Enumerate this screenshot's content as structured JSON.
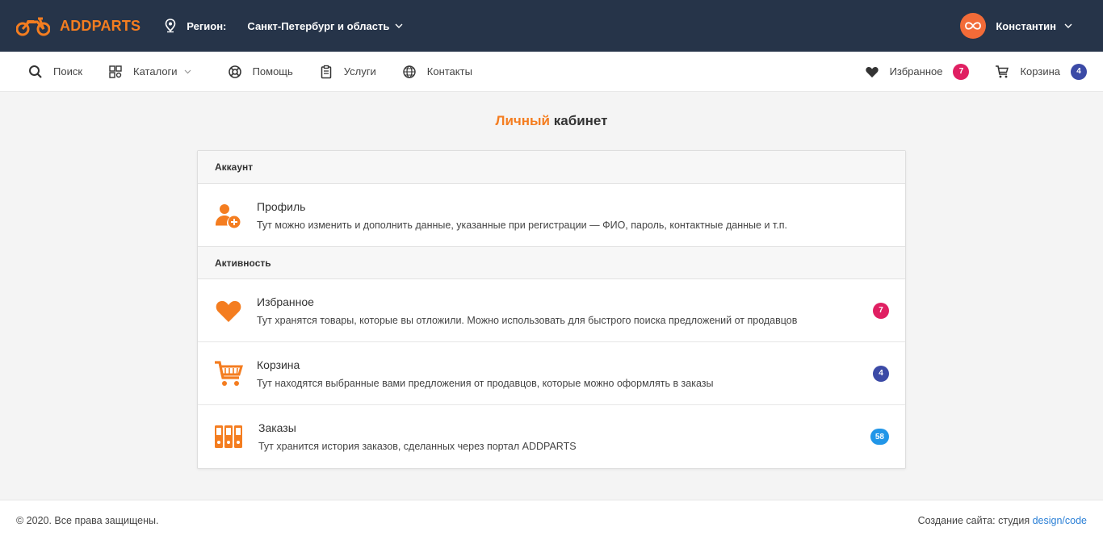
{
  "brand": {
    "name": "ADDPARTS",
    "accent": "#f47d20"
  },
  "header": {
    "region_label": "Регион:",
    "region_value": "Санкт-Петербург и область",
    "user_name": "Константин"
  },
  "nav": {
    "search": "Поиск",
    "catalogs": "Каталоги",
    "help": "Помощь",
    "services": "Услуги",
    "contacts": "Контакты",
    "favorites": "Избранное",
    "favorites_count": "7",
    "cart": "Корзина",
    "cart_count": "4"
  },
  "page": {
    "title_accent": "Личный",
    "title_rest": " кабинет"
  },
  "sections": {
    "account": {
      "heading": "Аккаунт",
      "profile_title": "Профиль",
      "profile_desc": "Тут можно изменить и дополнить данные, указанные при регистрации — ФИО, пароль, контактные данные и т.п."
    },
    "activity": {
      "heading": "Активность",
      "favorites_title": "Избранное",
      "favorites_desc": "Тут хранятся товары, которые вы отложили. Можно использовать для быстрого поиска предложений от продавцов",
      "favorites_count": "7",
      "cart_title": "Корзина",
      "cart_desc": "Тут находятся выбранные вами предложения от продавцов, которые можно оформлять в заказы",
      "cart_count": "4",
      "orders_title": "Заказы",
      "orders_desc": "Тут хранится история заказов, сделанных через портал ADDPARTS",
      "orders_count": "58"
    }
  },
  "footer": {
    "copyright": "© 2020. Все права защищены.",
    "credit_prefix": "Создание сайта: студия ",
    "credit_link": "design/code"
  },
  "colors": {
    "topbar": "#263449",
    "orange": "#f47d20",
    "badge_pink": "#e01f62",
    "badge_blue": "#3b4aa6",
    "badge_sky": "#2196e8"
  },
  "icons": [
    "motorcycle-icon",
    "map-pin-icon",
    "chevron-down-icon",
    "infinity-icon",
    "search-icon",
    "catalog-icon",
    "lifebuoy-icon",
    "clipboard-icon",
    "globe-icon",
    "heart-icon",
    "cart-icon",
    "add-user-icon",
    "folders-icon"
  ]
}
